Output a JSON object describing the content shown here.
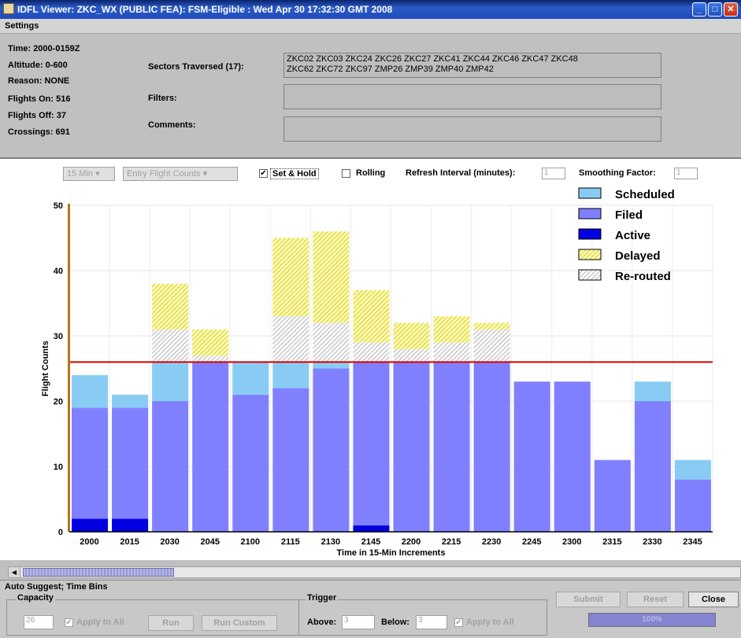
{
  "window": {
    "title": "IDFL Viewer:  ZKC_WX (PUBLIC FEA):  FSM-Eligible : Wed Apr 30 17:32:30 GMT 2008"
  },
  "settings": {
    "header": "Settings",
    "time": "Time: 2000-0159Z",
    "altitude": "Altitude: 0-600",
    "reason": "Reason: NONE",
    "flights_on": "Flights On: 516",
    "flights_off": "Flights Off: 37",
    "crossings": "Crossings: 691",
    "sectors_label": "Sectors Traversed (17):",
    "sectors_line1": "ZKC02 ZKC03 ZKC24 ZKC26 ZKC27 ZKC41 ZKC44 ZKC46 ZKC47 ZKC48",
    "sectors_line2": "ZKC62 ZKC72 ZKC97 ZMP26 ZMP39 ZMP40 ZMP42",
    "filters_label": "Filters:",
    "comments_label": "Comments:"
  },
  "controls": {
    "interval": "15 Min",
    "count_type": "Entry Flight Counts",
    "set_hold": "Set & Hold",
    "set_hold_checked": true,
    "rolling": "Rolling",
    "rolling_checked": false,
    "refresh_label": "Refresh Interval (minutes):",
    "refresh_value": "1",
    "smoothing_label": "Smoothing Factor:",
    "smoothing_value": "1"
  },
  "chart_data": {
    "type": "bar",
    "stacked": true,
    "xlabel": "Time in 15-Min Increments",
    "ylabel": "Flight Counts",
    "ylim": [
      0,
      50
    ],
    "yticks": [
      0,
      10,
      20,
      30,
      40,
      50
    ],
    "categories": [
      "2000",
      "2015",
      "2030",
      "2045",
      "2100",
      "2115",
      "2130",
      "2145",
      "2200",
      "2215",
      "2230",
      "2245",
      "2300",
      "2315",
      "2330",
      "2345"
    ],
    "capacity_line": 26,
    "series": [
      {
        "name": "Active",
        "color": "#0000e0",
        "values": [
          2,
          2,
          0,
          0,
          0,
          0,
          0,
          1,
          0,
          0,
          0,
          0,
          0,
          0,
          0,
          0
        ]
      },
      {
        "name": "Filed",
        "color": "#8080ff",
        "values": [
          17,
          17,
          20,
          26,
          21,
          22,
          25,
          25,
          26,
          26,
          26,
          23,
          23,
          11,
          20,
          8
        ]
      },
      {
        "name": "Scheduled",
        "color": "#88ccf4",
        "values": [
          5,
          2,
          6,
          0,
          5,
          4,
          1,
          0,
          0,
          0,
          0,
          0,
          0,
          0,
          3,
          3
        ]
      },
      {
        "name": "Re-routed",
        "color": "#e8e8e8",
        "values": [
          0,
          0,
          5,
          1,
          0,
          7,
          6,
          3,
          2,
          3,
          5,
          0,
          0,
          0,
          0,
          0
        ]
      },
      {
        "name": "Delayed",
        "color": "#f0f080",
        "values": [
          0,
          0,
          7,
          4,
          0,
          12,
          14,
          8,
          4,
          4,
          1,
          0,
          0,
          0,
          0,
          0
        ]
      }
    ],
    "legend_order": [
      "Scheduled",
      "Filed",
      "Active",
      "Delayed",
      "Re-routed"
    ],
    "legend_position": "top-right"
  },
  "bottom": {
    "section_title": "Auto Suggest; Time Bins",
    "capacity_title": "Capacity",
    "capacity_value": "26",
    "apply_all": "Apply to All",
    "run": "Run",
    "run_custom": "Run Custom",
    "trigger_title": "Trigger",
    "above_label": "Above:",
    "above_value": "3",
    "below_label": "Below:",
    "below_value": "3",
    "apply_all2": "Apply to All",
    "submit": "Submit",
    "reset": "Reset",
    "close": "Close",
    "progress": "100%",
    "progress_fraction": 1.0
  }
}
